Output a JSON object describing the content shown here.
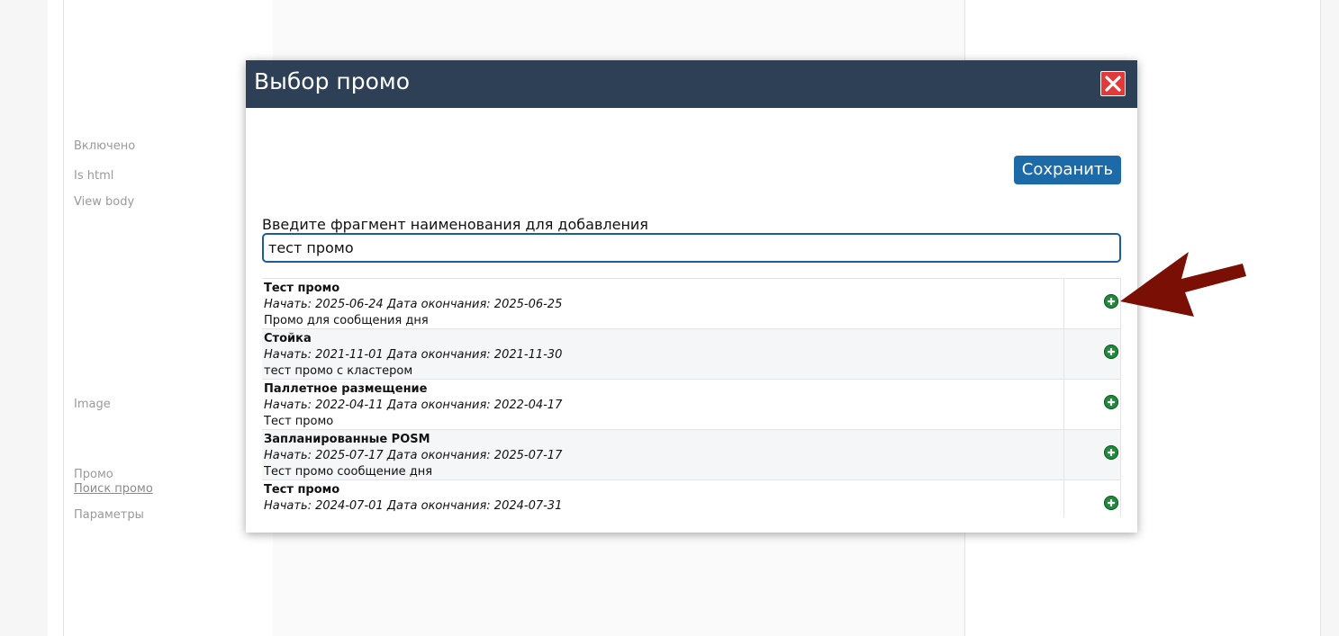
{
  "background": {
    "labels": {
      "enabled": "Включено",
      "is_html": "Is html",
      "view_body": "View body",
      "image": "Image",
      "promo": "Промо",
      "search_promo": "Поиск промо",
      "params": "Параметры"
    }
  },
  "modal": {
    "title": "Выбор промо",
    "save_label": "Сохранить",
    "input_label": "Введите фрагмент наименования для добавления",
    "search_value": "тест промо",
    "results": [
      {
        "name": "Тест промо",
        "dates": "Начать: 2025-06-24 Дата окончания: 2025-06-25",
        "description": "Промо для сообщения дня"
      },
      {
        "name": "Стойка",
        "dates": "Начать: 2021-11-01 Дата окончания: 2021-11-30",
        "description": "тест промо с кластером"
      },
      {
        "name": "Паллетное размещение",
        "dates": "Начать: 2022-04-11 Дата окончания: 2022-04-17",
        "description": "Тест промо"
      },
      {
        "name": "Запланированные POSM",
        "dates": "Начать: 2025-07-17 Дата окончания: 2025-07-17",
        "description": "Тест промо сообщение дня"
      },
      {
        "name": "Тест промо",
        "dates": "Начать: 2024-07-01 Дата окончания: 2024-07-31",
        "description": ""
      }
    ]
  },
  "icons": {
    "close": "close-icon",
    "add": "plus-circle-icon",
    "annotation": "arrow-annotation"
  },
  "colors": {
    "header_bg": "#2d4055",
    "save_button": "#1c6aa7",
    "close_button": "#e23a3a",
    "add_icon": "#1f8a3b",
    "arrow": "#7a0f05"
  }
}
